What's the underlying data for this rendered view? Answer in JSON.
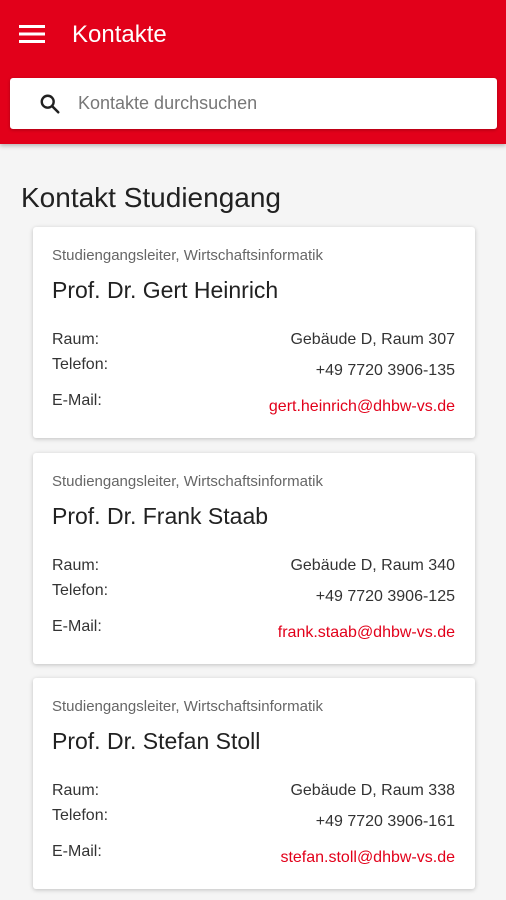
{
  "appbar": {
    "title": "Kontakte",
    "menu_icon": "hamburger-menu-icon",
    "background_color": "#e2001a"
  },
  "search": {
    "placeholder": "Kontakte durchsuchen",
    "value": "",
    "icon": "search-icon"
  },
  "section": {
    "title": "Kontakt Studiengang"
  },
  "labels": {
    "raum": "Raum:",
    "telefon": "Telefon:",
    "email": "E-Mail:"
  },
  "contacts": [
    {
      "role": "Studiengangsleiter, Wirtschaftsinformatik",
      "name": "Prof. Dr. Gert Heinrich",
      "raum": "Gebäude D, Raum 307",
      "telefon": "+49 7720 3906-135",
      "email": "gert.heinrich@dhbw-vs.de"
    },
    {
      "role": "Studiengangsleiter, Wirtschaftsinformatik",
      "name": "Prof. Dr. Frank Staab",
      "raum": "Gebäude D, Raum 340",
      "telefon": "+49 7720 3906-125",
      "email": "frank.staab@dhbw-vs.de"
    },
    {
      "role": "Studiengangsleiter, Wirtschaftsinformatik",
      "name": "Prof. Dr. Stefan Stoll",
      "raum": "Gebäude D, Raum 338",
      "telefon": "+49 7720 3906-161",
      "email": "stefan.stoll@dhbw-vs.de"
    }
  ],
  "colors": {
    "accent": "#e2001a",
    "link": "#e2001a"
  }
}
